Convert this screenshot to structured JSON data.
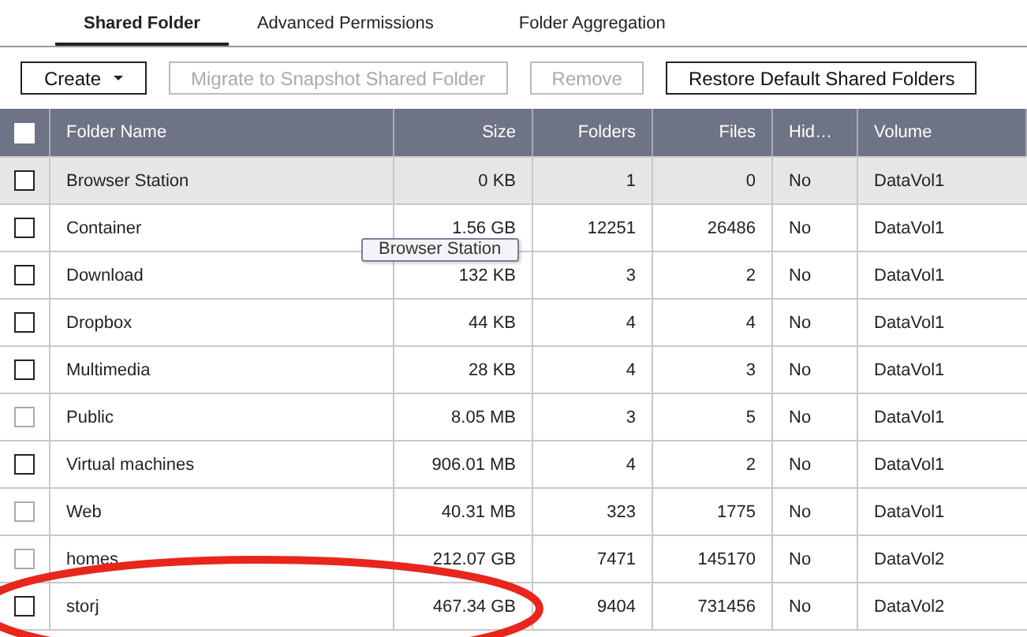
{
  "tabs": [
    {
      "label": "Shared Folder",
      "selected": true
    },
    {
      "label": "Advanced Permissions",
      "selected": false
    },
    {
      "label": "Folder Aggregation",
      "selected": false
    }
  ],
  "toolbar": [
    {
      "label": "Create",
      "kind": "dropdown",
      "disabled": false
    },
    {
      "label": "Migrate to Snapshot Shared Folder",
      "kind": "button",
      "disabled": true
    },
    {
      "label": "Remove",
      "kind": "button",
      "disabled": true
    },
    {
      "label": "Restore Default Shared Folders",
      "kind": "button",
      "disabled": false
    }
  ],
  "table": {
    "select_all": {
      "checked": false
    },
    "columns": [
      "Folder Name",
      "Size",
      "Folders",
      "Files",
      "Hid…",
      "Volume"
    ],
    "rows": [
      {
        "selected": true,
        "checked": false,
        "disabled": false,
        "cells": [
          "Browser Station",
          "0 KB",
          "1",
          "0",
          "No",
          "DataVol1"
        ]
      },
      {
        "selected": false,
        "checked": false,
        "disabled": false,
        "cells": [
          "Container",
          "1.56 GB",
          "12251",
          "26486",
          "No",
          "DataVol1"
        ]
      },
      {
        "selected": false,
        "checked": false,
        "disabled": false,
        "cells": [
          "Download",
          "132 KB",
          "3",
          "2",
          "No",
          "DataVol1"
        ]
      },
      {
        "selected": false,
        "checked": false,
        "disabled": false,
        "cells": [
          "Dropbox",
          "44 KB",
          "4",
          "4",
          "No",
          "DataVol1"
        ]
      },
      {
        "selected": false,
        "checked": false,
        "disabled": false,
        "cells": [
          "Multimedia",
          "28 KB",
          "4",
          "3",
          "No",
          "DataVol1"
        ]
      },
      {
        "selected": false,
        "checked": false,
        "disabled": true,
        "cells": [
          "Public",
          "8.05 MB",
          "3",
          "5",
          "No",
          "DataVol1"
        ]
      },
      {
        "selected": false,
        "checked": false,
        "disabled": false,
        "cells": [
          "Virtual machines",
          "906.01 MB",
          "4",
          "2",
          "No",
          "DataVol1"
        ]
      },
      {
        "selected": false,
        "checked": false,
        "disabled": true,
        "cells": [
          "Web",
          "40.31 MB",
          "323",
          "1775",
          "No",
          "DataVol1"
        ]
      },
      {
        "selected": false,
        "checked": false,
        "disabled": true,
        "cells": [
          "homes",
          "212.07 GB",
          "7471",
          "145170",
          "No",
          "DataVol2"
        ]
      },
      {
        "selected": false,
        "checked": false,
        "disabled": false,
        "cells": [
          "storj",
          "467.34 GB",
          "9404",
          "731456",
          "No",
          "DataVol2"
        ]
      }
    ]
  },
  "tooltip": {
    "text": "Browser Station"
  }
}
